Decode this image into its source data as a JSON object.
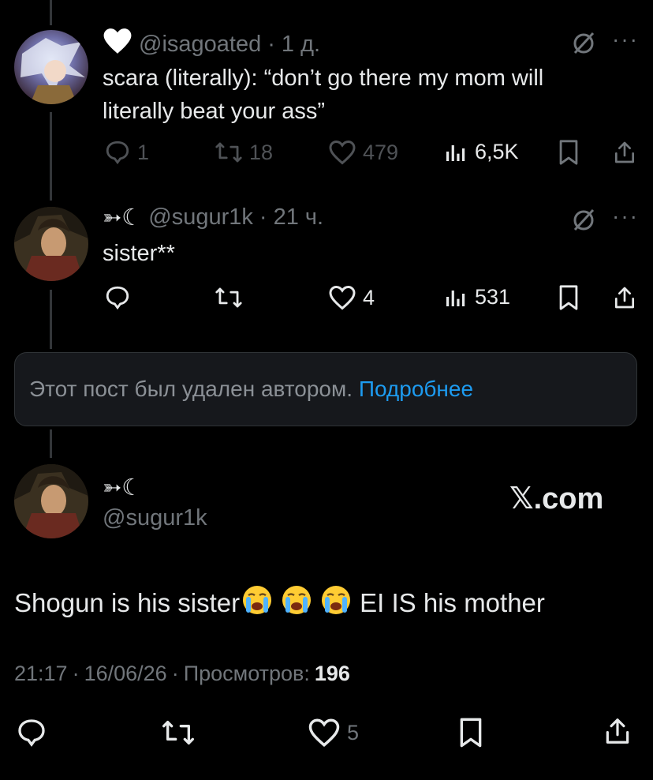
{
  "colors": {
    "background": "#000000",
    "text": "#e7e9ea",
    "muted": "#71767b",
    "link": "#1d9bf0",
    "card": "#16181c"
  },
  "tweet1": {
    "display_name_icon": "white-heart-emoji",
    "handle": "@isagoated",
    "time": "1 д.",
    "text_line1": "scara (literally): “don’t go there my mom will",
    "text_line2": "literally beat your ass”",
    "replies": "1",
    "reposts": "18",
    "likes": "479",
    "views": "6,5K"
  },
  "tweet2": {
    "display_name": "➳☾",
    "handle": "@sugur1k",
    "time": "21 ч.",
    "text": "sister**",
    "likes": "4",
    "views": "531"
  },
  "deleted_notice": {
    "text": "Этот пост был удален автором.",
    "link": "Подробнее"
  },
  "main_tweet": {
    "display_name": "➳☾",
    "handle": "@sugur1k",
    "watermark": "𝕏.com",
    "text_before": "Shogun is his sister",
    "text_after": "EI IS his mother",
    "emoji": [
      "loudly-crying-face",
      "loudly-crying-face",
      "loudly-crying-face"
    ],
    "time": "21:17",
    "date": "16/06/26",
    "views_label": "Просмотров:",
    "views_count": "196",
    "likes": "5"
  },
  "separator": "·"
}
